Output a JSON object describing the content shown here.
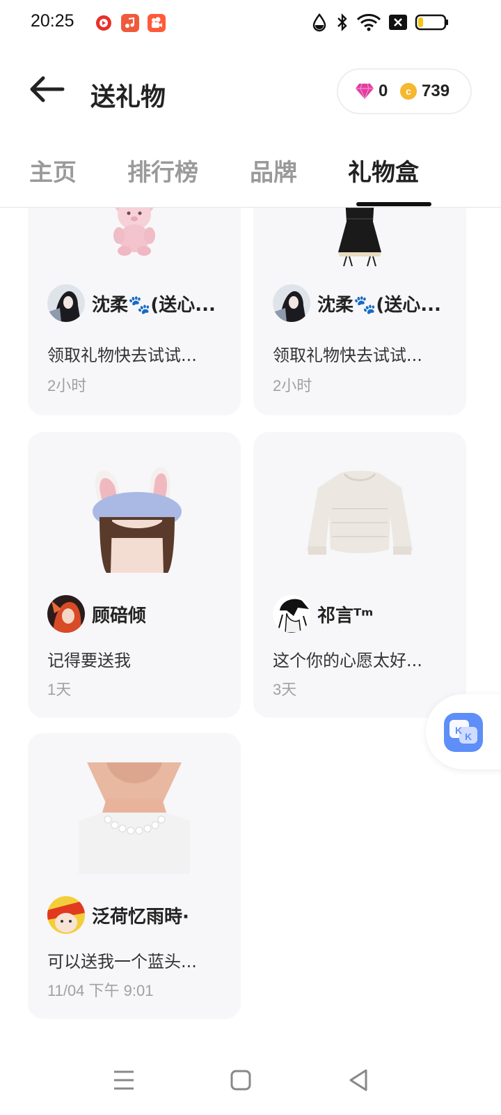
{
  "status_bar": {
    "time": "20:25",
    "apps": [
      "video-app-icon",
      "music-app-icon",
      "kuaishou-app-icon"
    ],
    "indicators": [
      "drop-icon",
      "bluetooth-icon",
      "wifi-icon",
      "close-box-icon",
      "battery-icon"
    ],
    "battery_level": 0.2
  },
  "header": {
    "title": "送礼物",
    "diamonds": "0",
    "coins": "739"
  },
  "tabs": [
    {
      "label": "主页",
      "active": false
    },
    {
      "label": "排行榜",
      "active": false
    },
    {
      "label": "品牌",
      "active": false
    },
    {
      "label": "礼物盒",
      "active": true
    }
  ],
  "cards": [
    {
      "item": "pink-teddy-bear",
      "user": "沈柔🐾(送心...",
      "message": "领取礼物快去试试...",
      "time": "2小时"
    },
    {
      "item": "black-dress",
      "user": "沈柔🐾(送心...",
      "message": "领取礼物快去试试...",
      "time": "2小时"
    },
    {
      "item": "bunny-ears-beret",
      "user": "顾碚倾",
      "message": "记得要送我",
      "time": "1天"
    },
    {
      "item": "knit-sweater",
      "user": "祁言ᵀᵐ",
      "message": "这个你的心愿太好...",
      "time": "3天"
    },
    {
      "item": "pearl-necklace",
      "user": "泛荷忆雨時·",
      "message": "可以送我一个蓝头...",
      "time": "11/04 下午 9:01"
    }
  ],
  "colors": {
    "accent": "#5e8ef7",
    "card_bg": "#f7f7f9",
    "diamond": "#e040a0",
    "coin": "#f5b82e"
  }
}
